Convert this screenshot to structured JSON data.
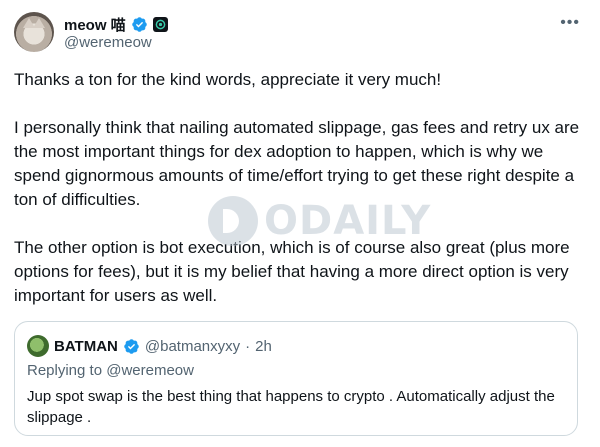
{
  "post": {
    "author": {
      "name": "meow 喵",
      "handle": "@weremeow"
    },
    "more_label": "•••",
    "paragraphs": [
      "Thanks a ton for the kind words, appreciate it very much!",
      "I personally think that nailing automated slippage, gas fees and retry ux are the most important things for dex adoption to happen, which is why we spend gignormous amounts of time/effort trying to get these right despite a ton of difficulties.",
      "The other option is bot execution, which is of course also great (plus more options for fees), but it is my belief that having a more direct option is very important for users as well."
    ]
  },
  "quote": {
    "author": {
      "name": "BATMAN",
      "handle": "@batmanxyxy",
      "separator": "·",
      "time": "2h"
    },
    "replying_to": "Replying to @weremeow",
    "text": "Jup spot swap is the best thing that happens to crypto . Automatically adjust the slippage ."
  },
  "watermark": {
    "text": "ODAILY"
  },
  "colors": {
    "verified_blue": "#1d9bf0",
    "secondary_text": "#536471",
    "border": "#cfd9de"
  }
}
